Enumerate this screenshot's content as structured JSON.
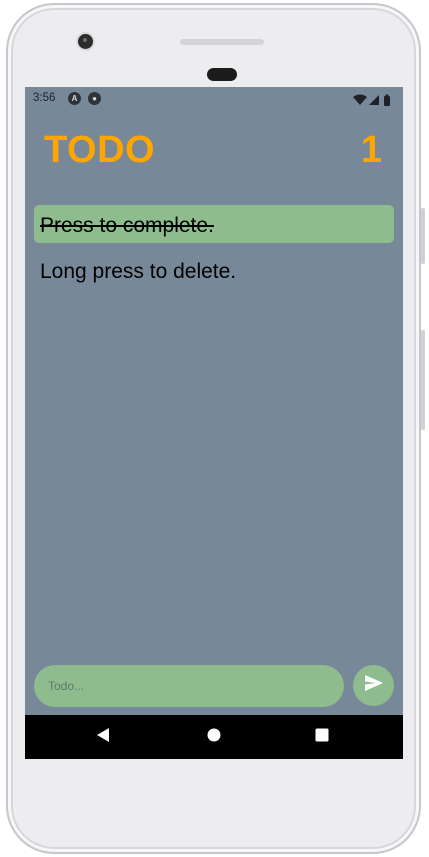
{
  "status_bar": {
    "time": "3:56",
    "notification_icons": [
      "accessibility-icon",
      "app-notification-icon"
    ],
    "system_icons": [
      "wifi-icon",
      "signal-icon",
      "battery-icon"
    ]
  },
  "header": {
    "title": "TODO",
    "count": "1"
  },
  "todos": [
    {
      "text": "Press to complete.",
      "completed": true
    },
    {
      "text": "Long press to delete.",
      "completed": false
    }
  ],
  "composer": {
    "placeholder": "Todo...",
    "value": "",
    "send_icon": "send-icon"
  },
  "navigation": [
    "back-icon",
    "home-icon",
    "recents-icon"
  ],
  "colors": {
    "background": "#778899",
    "accent": "#FFA500",
    "completed_item": "#8FBC8F",
    "input": "#8FBC8F",
    "nav_bar": "#000000"
  }
}
